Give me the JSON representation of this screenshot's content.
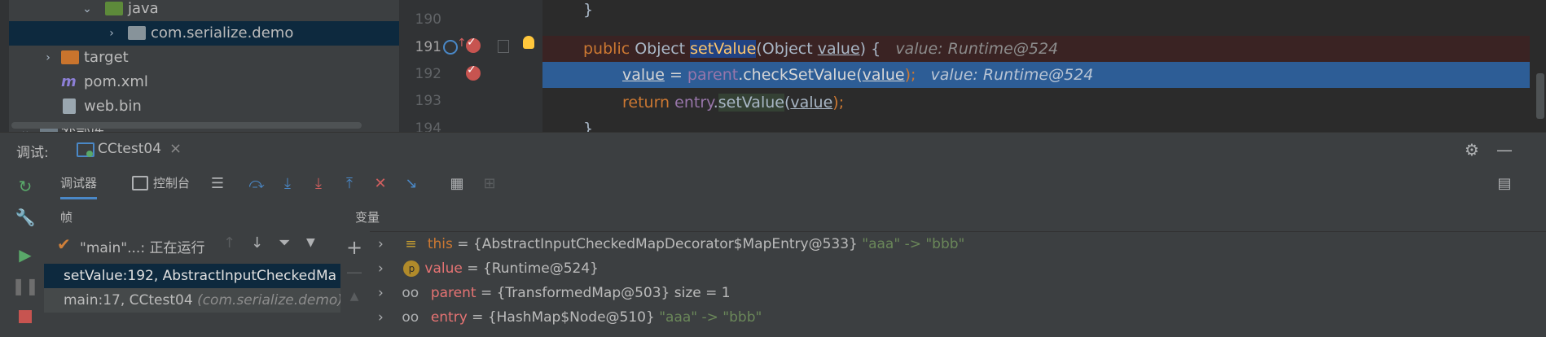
{
  "project_tree": {
    "items": [
      {
        "label": "java",
        "icon": "folder-icon"
      },
      {
        "label": "com.serialize.demo",
        "icon": "package-icon"
      },
      {
        "label": "target",
        "icon": "folder-icon"
      },
      {
        "label": "pom.xml",
        "icon": "maven-icon"
      },
      {
        "label": "web.bin",
        "icon": "file-icon"
      },
      {
        "label": "外部库",
        "icon": "library-icon"
      }
    ]
  },
  "editor": {
    "line_numbers": [
      "190",
      "191",
      "192",
      "193",
      "194"
    ],
    "line191": {
      "kw": "public",
      "type": "Object",
      "method": "setValue",
      "open": "(",
      "ptype": "Object",
      "param": "value",
      "close": ") {",
      "hint": "value: Runtime@524"
    },
    "line192": {
      "var": "value",
      "assign": " = ",
      "field": "parent",
      "dot": ".",
      "method": "checkSetValue",
      "open": "(",
      "arg": "value",
      "close": ");",
      "hint": "value: Runtime@524"
    },
    "line193": {
      "kw": "return",
      "obj": "entry",
      "dot": ".",
      "method": "setValue",
      "open": "(",
      "arg": "value",
      "close": ");"
    },
    "line190": "}",
    "line194": "}"
  },
  "debug": {
    "label": "调试:",
    "session_tab": "CCtest04",
    "close_glyph": "×",
    "subtabs": {
      "debugger": "调试器",
      "console": "控制台"
    },
    "frames_title": "帧",
    "thread": "\"main\"...: 正在运行",
    "frames": [
      {
        "method": "setValue:192, AbstractInputCheckedMa",
        "loc": ""
      },
      {
        "method": "main:17, CCtest04",
        "loc": "(com.serialize.demo)"
      }
    ],
    "variables_title": "变量",
    "variables": [
      {
        "name": "this",
        "eq": " = ",
        "val": "{AbstractInputCheckedMapDecorator$MapEntry@533}",
        "extra": "\"aaa\" -> \"bbb\""
      },
      {
        "name": "value",
        "eq": " = ",
        "val": "{Runtime@524}",
        "extra": ""
      },
      {
        "name": "parent",
        "eq": " = ",
        "val": "{TransformedMap@503}",
        "extra": " size = 1"
      },
      {
        "name": "entry",
        "eq": " = ",
        "val": "{HashMap$Node@510}",
        "extra": "\"aaa\" -> \"bbb\""
      }
    ]
  },
  "colors": {
    "accent": "#4a88c7",
    "breakpoint": "#c75450",
    "selected_line": "#2d5d96"
  }
}
